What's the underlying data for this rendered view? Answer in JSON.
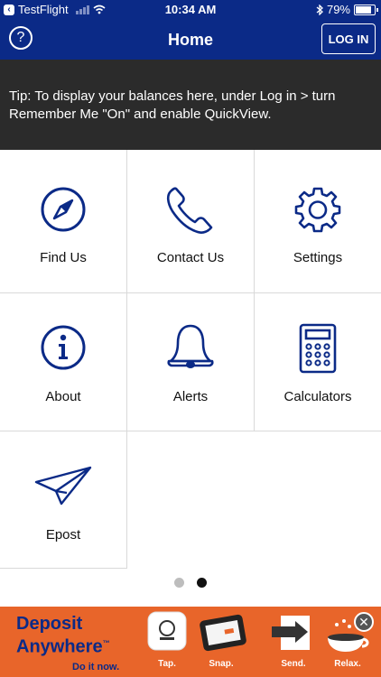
{
  "status_bar": {
    "back_app": "TestFlight",
    "time": "10:34 AM",
    "battery": "79%"
  },
  "nav": {
    "title": "Home",
    "login_label": "LOG IN",
    "help_glyph": "?"
  },
  "tip": {
    "text": "Tip: To display your balances here, under Log in > turn Remember Me \"On\" and enable QuickView."
  },
  "tiles": [
    {
      "label": "Find Us",
      "icon": "compass-icon"
    },
    {
      "label": "Contact Us",
      "icon": "phone-icon"
    },
    {
      "label": "Settings",
      "icon": "gear-icon"
    },
    {
      "label": "About",
      "icon": "info-icon"
    },
    {
      "label": "Alerts",
      "icon": "bell-icon"
    },
    {
      "label": "Calculators",
      "icon": "calculator-icon"
    },
    {
      "label": "Epost",
      "icon": "paper-plane-icon"
    }
  ],
  "pager": {
    "count": 2,
    "active_index": 1
  },
  "ad": {
    "brand_line1": "Deposit",
    "brand_line2": "Anywhere",
    "tm": "™",
    "cta": "Do it now.",
    "steps": [
      {
        "label": "Tap."
      },
      {
        "label": "Snap."
      },
      {
        "label": "Send."
      },
      {
        "label": "Relax."
      }
    ]
  },
  "colors": {
    "brand_blue": "#0b2a87",
    "tip_bg": "#2b2b2b",
    "ad_orange": "#e8652a"
  }
}
